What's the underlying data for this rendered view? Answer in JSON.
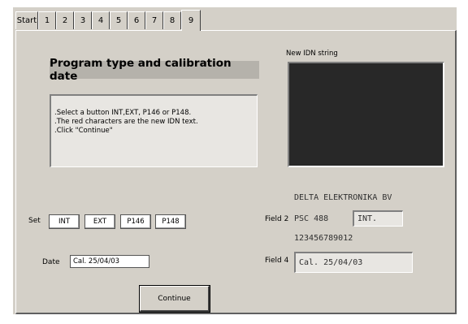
{
  "tabs": [
    "Start",
    "1",
    "2",
    "3",
    "4",
    "5",
    "6",
    "7",
    "8",
    "9"
  ],
  "active_tab": "9",
  "title": "Program type and calibration date",
  "instructions": [
    ".Select a button INT,EXT, P146 or P148.",
    ".The red characters are the new IDN text.",
    ".Click \"Continue\""
  ],
  "idn": {
    "label": "New IDN string",
    "manufacturer": "DELTA ELEKTRONIKA BV",
    "field2_label": "Field 2",
    "field2_model": "PSC 488",
    "field2_value": "INT.",
    "serial": "123456789012",
    "field4_label": "Field 4",
    "field4_value": "Cal. 25/04/03"
  },
  "set": {
    "label": "Set",
    "buttons": [
      "INT",
      "EXT",
      "P146",
      "P148"
    ]
  },
  "date": {
    "label": "Date",
    "value": "Cal. 25/04/03"
  },
  "continue_label": "Continue"
}
